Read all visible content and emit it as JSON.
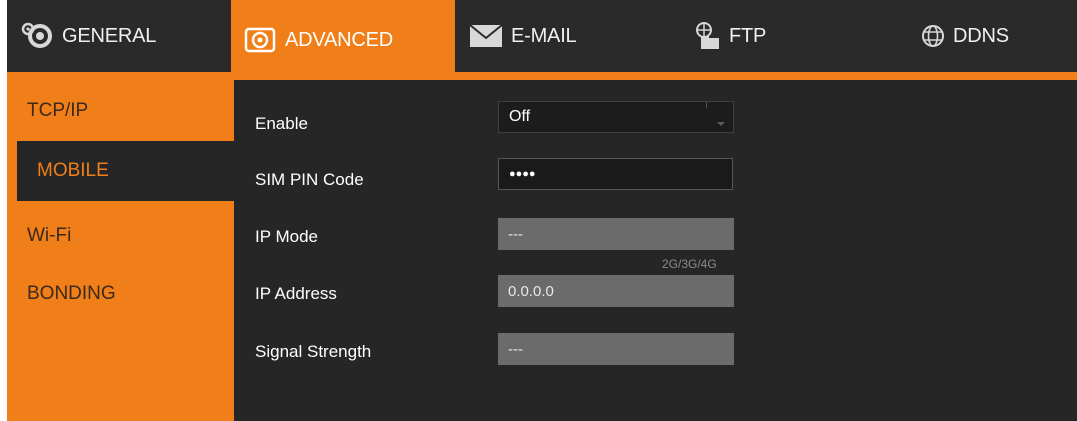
{
  "tabs": [
    {
      "label": "GENERAL",
      "icon": "gear-icon"
    },
    {
      "label": "ADVANCED",
      "icon": "camera-icon",
      "active": true
    },
    {
      "label": "E-MAIL",
      "icon": "envelope-icon"
    },
    {
      "label": "FTP",
      "icon": "folder-network-icon"
    },
    {
      "label": "DDNS",
      "icon": "globe-icon"
    }
  ],
  "sidebar": {
    "items": [
      {
        "label": "TCP/IP"
      },
      {
        "label": "MOBILE",
        "active": true
      },
      {
        "label": "Wi-Fi"
      },
      {
        "label": "BONDING"
      }
    ]
  },
  "form": {
    "enable": {
      "label": "Enable",
      "value": "Off"
    },
    "sim_pin": {
      "label": "SIM PIN Code",
      "value": "●●●●"
    },
    "ip_mode": {
      "label": "IP Mode",
      "value": "---",
      "hint": "2G/3G/4G"
    },
    "ip_address": {
      "label": "IP Address",
      "value": "0.0.0.0"
    },
    "signal_strength": {
      "label": "Signal Strength",
      "value": "---"
    }
  },
  "colors": {
    "accent": "#f07f1a",
    "background": "#262626",
    "readonly_field": "#6b6b6b"
  }
}
